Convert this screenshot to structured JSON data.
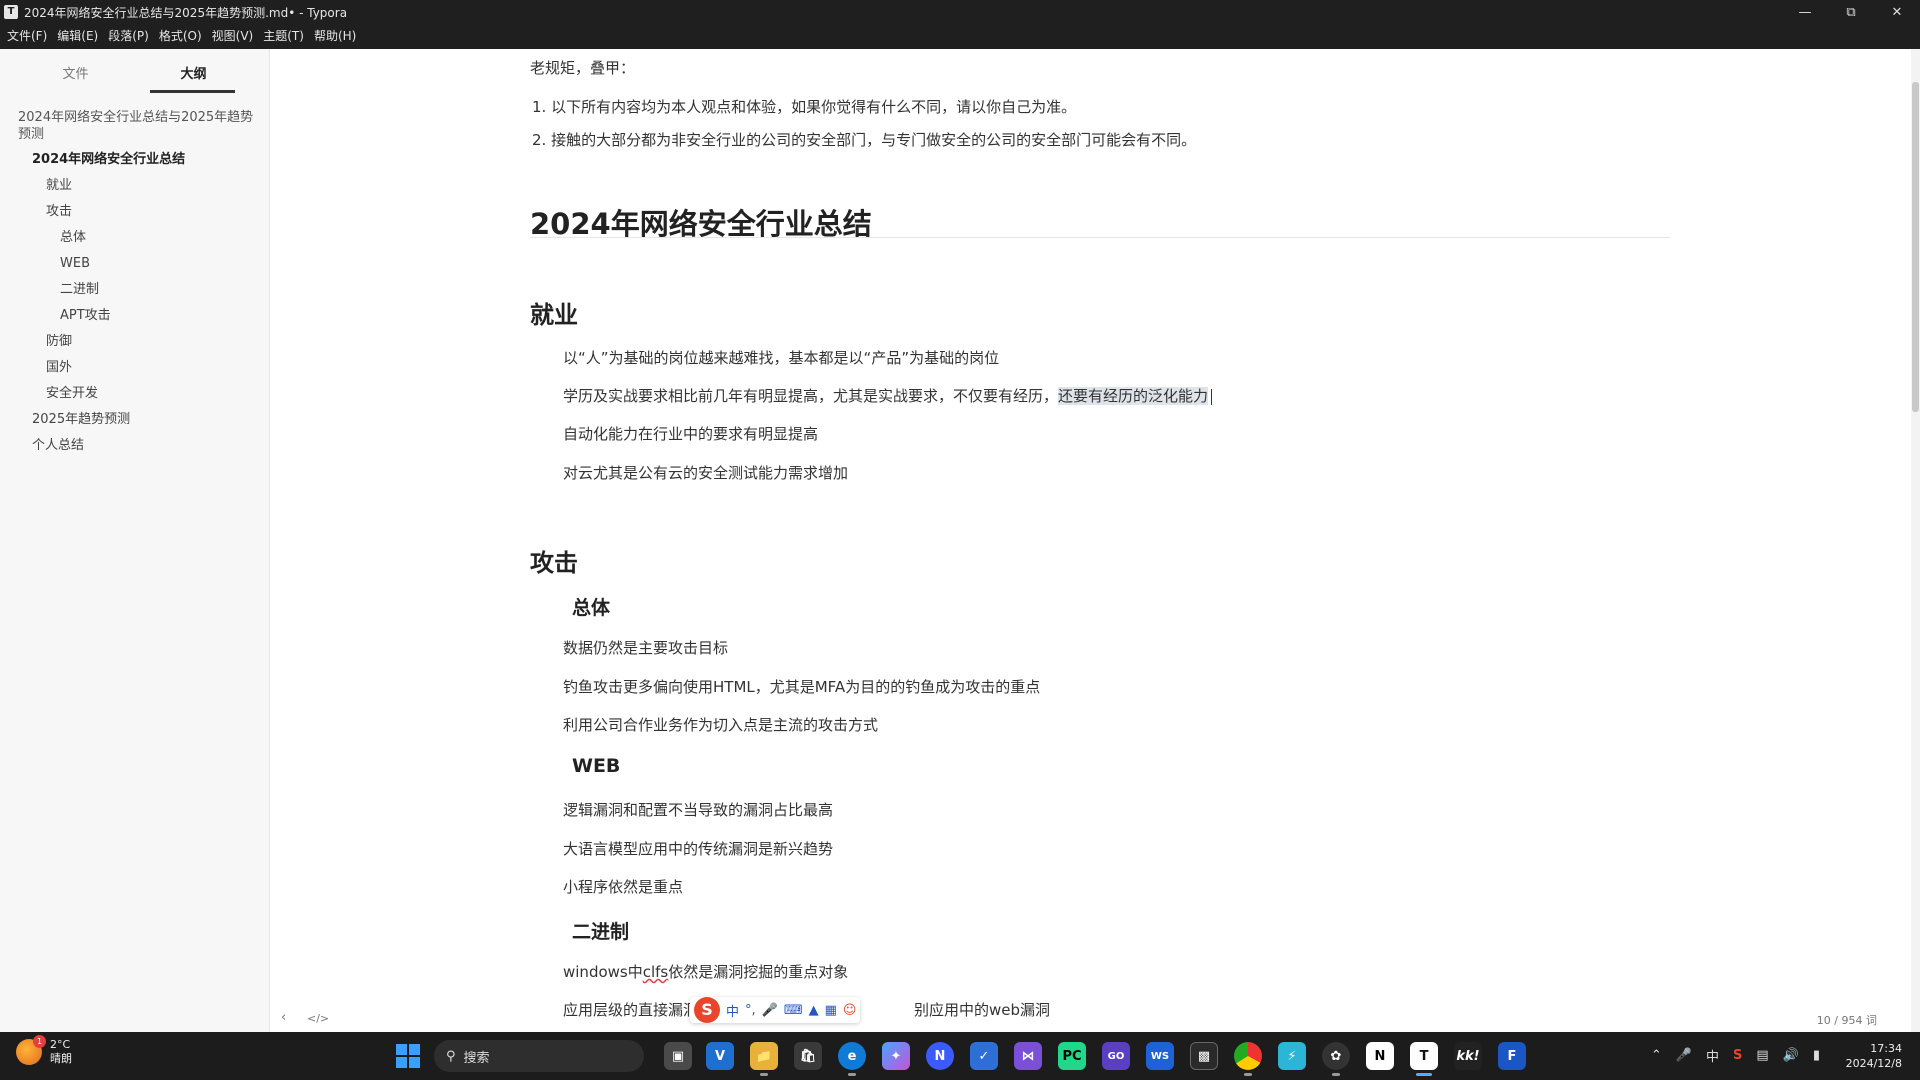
{
  "window": {
    "title": "2024年网络安全行业总结与2025年趋势预测.md• - Typora",
    "app_icon": "T"
  },
  "menu": [
    "文件(F)",
    "编辑(E)",
    "段落(P)",
    "格式(O)",
    "视图(V)",
    "主题(T)",
    "帮助(H)"
  ],
  "sidebar": {
    "tabs": [
      {
        "label": "文件",
        "active": false
      },
      {
        "label": "大纲",
        "active": true
      }
    ],
    "outline": [
      {
        "label": "2024年网络安全行业总结与2025年趋势预测",
        "level": 1
      },
      {
        "label": "2024年网络安全行业总结",
        "level": 2,
        "bold": true
      },
      {
        "label": "就业",
        "level": 3
      },
      {
        "label": "攻击",
        "level": 3
      },
      {
        "label": "总体",
        "level": 4
      },
      {
        "label": "WEB",
        "level": 4
      },
      {
        "label": "二进制",
        "level": 4
      },
      {
        "label": "APT攻击",
        "level": 4
      },
      {
        "label": "防御",
        "level": 3
      },
      {
        "label": "国外",
        "level": 3
      },
      {
        "label": "安全开发",
        "level": 3
      },
      {
        "label": "2025年趋势预测",
        "level": 2
      },
      {
        "label": "个人总结",
        "level": 2
      }
    ]
  },
  "document": {
    "intro": "老规矩，叠甲：",
    "disclaimer": [
      "以下所有内容均为本人观点和体验，如果你觉得有什么不同，请以你自己为准。",
      "接触的大部分都为非安全行业的公司的安全部门，与专门做安全的公司的安全部门可能会有不同。"
    ],
    "h1": "2024年网络安全行业总结",
    "employment": {
      "heading": "就业",
      "items": [
        "以“人”为基础的岗位越来越难找，基本都是以“产品”为基础的岗位",
        "学历及实战要求相比前几年有明显提高，尤其是实战要求，不仅要有经历，",
        "自动化能力在行业中的要求有明显提高",
        "对云尤其是公有云的安全测试能力需求增加"
      ],
      "selected_text": "还要有经历的泛化能力"
    },
    "attack": {
      "heading": "攻击",
      "overall": {
        "heading": "总体",
        "items": [
          "数据仍然是主要攻击目标",
          "钓鱼攻击更多偏向使用HTML，尤其是MFA为目的的钓鱼成为攻击的重点",
          "利用公司合作业务作为切入点是主流的攻击方式"
        ]
      },
      "web": {
        "heading": "WEB",
        "items": [
          "逻辑漏洞和配置不当导致的漏洞占比最高",
          "大语言模型应用中的传统漏洞是新兴趋势",
          "小程序依然是重点"
        ]
      },
      "binary": {
        "heading": "二进制",
        "line1_prefix": "windows中",
        "line1_misspelled": "clfs",
        "line1_suffix": "依然是漏洞挖掘的重点对象",
        "line2_visible_start": "应用层级的直接漏洞",
        "line2_visible_end": "别应用中的web漏洞"
      }
    }
  },
  "status": {
    "word_count": "10 / 954 词",
    "back_icon": "chevron-left-icon",
    "source_icon": "code-icon"
  },
  "ime": {
    "logo": "S",
    "mode": "中",
    "punct": "°,"
  },
  "taskbar": {
    "weather_temp": "2°C",
    "weather_desc": "晴朗",
    "weather_badge": "1",
    "search_label": "搜索",
    "tray_ime": "中",
    "time": "17:34",
    "date": "2024/12/8"
  },
  "colors": {
    "accent": "#3aa0ff",
    "selection": "#dfe4ea",
    "titlebar": "#1f1f1f"
  }
}
